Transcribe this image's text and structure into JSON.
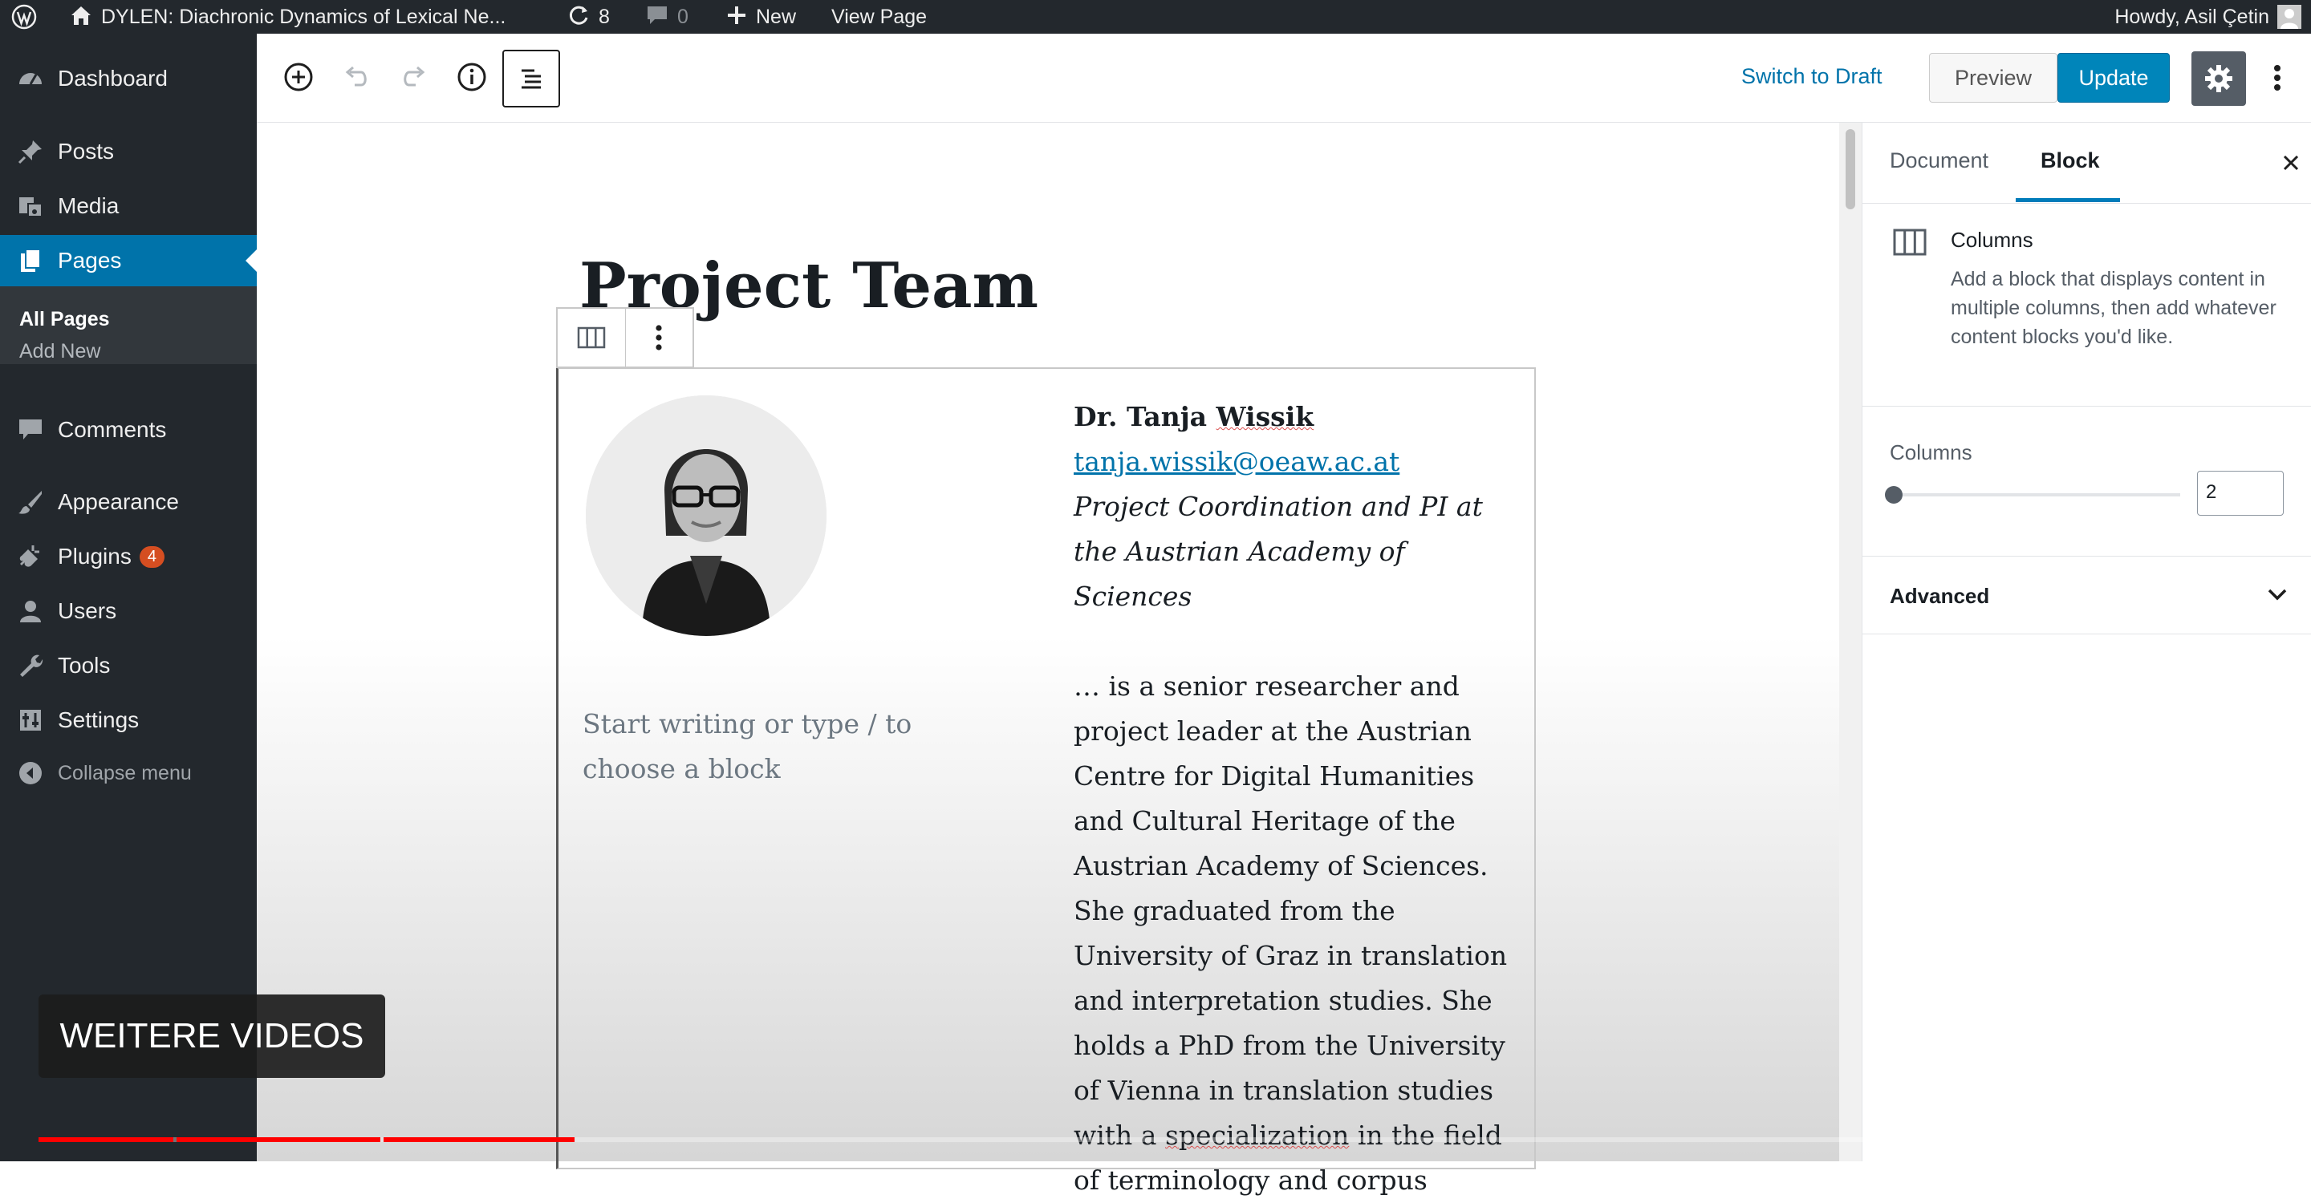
{
  "adminbar": {
    "site": "DYLEN: Diachronic Dynamics of Lexical Ne...",
    "updates": "8",
    "comments": "0",
    "new": "New",
    "view": "View Page",
    "howdy": "Howdy, Asil Çetin"
  },
  "sidebar": {
    "items": [
      {
        "label": "Dashboard",
        "icon": "dashboard-icon"
      },
      {
        "label": "Posts",
        "icon": "pin-icon"
      },
      {
        "label": "Media",
        "icon": "media-icon"
      },
      {
        "label": "Pages",
        "icon": "pages-icon"
      },
      {
        "label": "Comments",
        "icon": "comment-icon"
      },
      {
        "label": "Appearance",
        "icon": "brush-icon"
      },
      {
        "label": "Plugins",
        "icon": "plugin-icon",
        "badge": "4"
      },
      {
        "label": "Users",
        "icon": "user-icon"
      },
      {
        "label": "Tools",
        "icon": "wrench-icon"
      },
      {
        "label": "Settings",
        "icon": "settings-icon"
      },
      {
        "label": "Collapse menu",
        "icon": "collapse-icon"
      }
    ],
    "sub": [
      "All Pages",
      "Add New"
    ]
  },
  "toolbar": {
    "switch_draft": "Switch to Draft",
    "preview": "Preview",
    "update": "Update"
  },
  "content": {
    "title": "Project Team",
    "placeholder": "Start writing or type / to choose a block",
    "name_prefix": "Dr. Tanja ",
    "name_surname": "Wissik",
    "email": "tanja.wissik@oeaw.ac.at",
    "role": "Project Coordination and PI at the Austrian Academy of Sciences",
    "bio_a": "… is a senior researcher and project leader at the Austrian Centre for Digital Humanities and Cultural Heritage of the Austrian Academy of Sciences. She graduated from the University of Graz in translation and interpretation studies. She holds a PhD from the University of Vienna in translation studies with a ",
    "bio_word": "specialization",
    "bio_b": " in the field of terminology and corpus"
  },
  "settings_panel": {
    "tabs": [
      "Document",
      "Block"
    ],
    "block_name": "Columns",
    "block_desc": "Add a block that displays content in multiple columns, then add whatever content blocks you'd like.",
    "columns_label": "Columns",
    "columns_value": "2",
    "advanced": "Advanced"
  },
  "video": {
    "more_videos": "WEITERE VIDEOS",
    "progress_fraction": 0.24
  }
}
